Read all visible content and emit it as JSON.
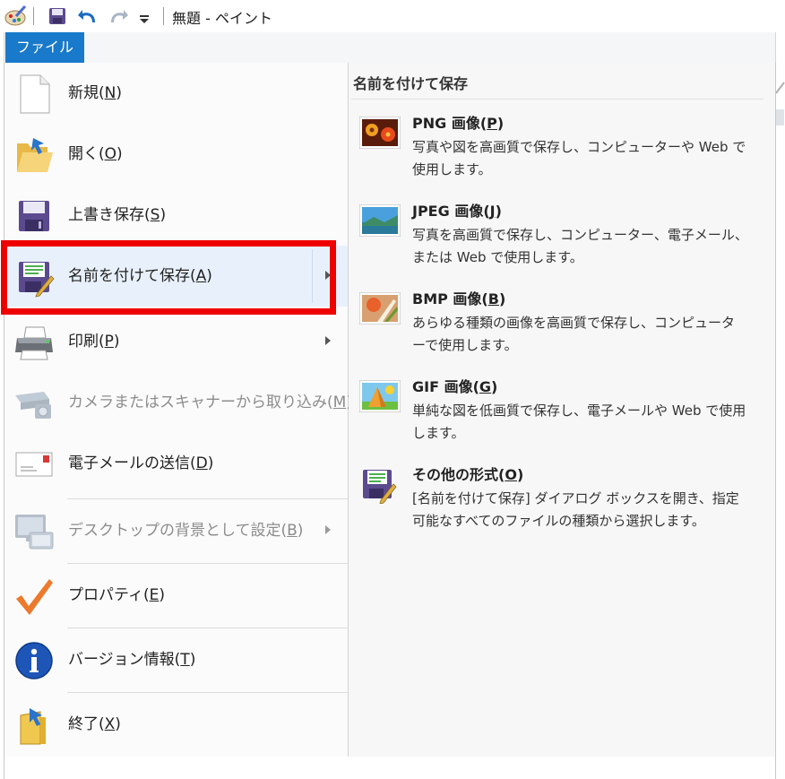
{
  "window": {
    "title": "無題 - ペイント"
  },
  "ribbon": {
    "file_tab": "ファイル"
  },
  "menu": {
    "items": [
      {
        "label": "新規(",
        "key": "N",
        "tail": ")"
      },
      {
        "label": "開く(",
        "key": "O",
        "tail": ")"
      },
      {
        "label": "上書き保存(",
        "key": "S",
        "tail": ")"
      },
      {
        "label": "名前を付けて保存(",
        "key": "A",
        "tail": ")"
      },
      {
        "label": "印刷(",
        "key": "P",
        "tail": ")"
      },
      {
        "label": "カメラまたはスキャナーから取り込み(",
        "key": "M",
        "tail": ")"
      },
      {
        "label": "電子メールの送信(",
        "key": "D",
        "tail": ")"
      },
      {
        "label": "デスクトップの背景として設定(",
        "key": "B",
        "tail": ")"
      },
      {
        "label": "プロパティ(",
        "key": "E",
        "tail": ")"
      },
      {
        "label": "バージョン情報(",
        "key": "T",
        "tail": ")"
      },
      {
        "label": "終了(",
        "key": "X",
        "tail": ")"
      }
    ]
  },
  "save_as_panel": {
    "title": "名前を付けて保存",
    "formats": [
      {
        "name": "PNG 画像(",
        "key": "P",
        "tail": ")",
        "desc": "写真や図を高画質で保存し、コンピューターや Web で使用します。"
      },
      {
        "name": "JPEG 画像(",
        "key": "J",
        "tail": ")",
        "desc": "写真を高画質で保存し、コンピューター、電子メール、または Web で使用します。"
      },
      {
        "name": "BMP 画像(",
        "key": "B",
        "tail": ")",
        "desc": "あらゆる種類の画像を高画質で保存し、コンピューターで使用します。"
      },
      {
        "name": "GIF 画像(",
        "key": "G",
        "tail": ")",
        "desc": "単純な図を低画質で保存し、電子メールや Web で使用します。"
      },
      {
        "name": "その他の形式(",
        "key": "O",
        "tail": ")",
        "desc": "[名前を付けて保存] ダイアログ ボックスを開き、指定可能なすべてのファイルの種類から選択します。"
      }
    ]
  },
  "colors": {
    "accent": "#1979ca",
    "highlight": "#ee0000",
    "hover": "#e8f1fb"
  }
}
